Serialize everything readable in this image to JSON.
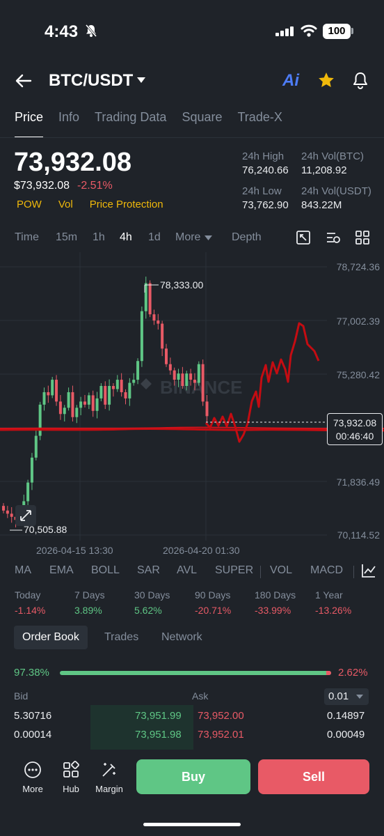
{
  "status_bar": {
    "time": "4:43",
    "battery": "100"
  },
  "header": {
    "pair": "BTC/USDT",
    "ai_label": "Ai"
  },
  "main_tabs": [
    {
      "label": "Price",
      "active": true
    },
    {
      "label": "Info"
    },
    {
      "label": "Trading Data"
    },
    {
      "label": "Square"
    },
    {
      "label": "Trade-X"
    }
  ],
  "price": {
    "last": "73,932.08",
    "fiat": "$73,932.08",
    "change": "-2.51%",
    "tags": [
      "POW",
      "Vol",
      "Price Protection"
    ]
  },
  "stats": {
    "high_label": "24h High",
    "high": "76,240.66",
    "vol_btc_label": "24h Vol(BTC)",
    "vol_btc": "11,208.92",
    "low_label": "24h Low",
    "low": "73,762.90",
    "vol_usdt_label": "24h Vol(USDT)",
    "vol_usdt": "843.22M"
  },
  "chart_toolbar": {
    "time": "Time",
    "m15": "15m",
    "h1": "1h",
    "h4": "4h",
    "d1": "1d",
    "more": "More",
    "depth": "Depth"
  },
  "chart_data": {
    "type": "candlestick",
    "interval": "4h",
    "y_ticks": [
      "78,724.36",
      "77,002.39",
      "75,280.42",
      "71,836.49",
      "70,114.52"
    ],
    "x_ticks": [
      "2026-04-15 13:30",
      "2026-04-20 01:30"
    ],
    "high_marker": "78,333.00",
    "low_marker": "70,505.88",
    "last_price_label": "73,932.08",
    "countdown": "00:46:40",
    "watermark": "BINANCE",
    "ylim": [
      70114.52,
      78724.36
    ],
    "candles_close": [
      70900,
      70800,
      70700,
      70600,
      70650,
      71200,
      71800,
      72600,
      73300,
      74300,
      74700,
      74600,
      75100,
      74400,
      74000,
      74200,
      74700,
      73900,
      74200,
      74400,
      74300,
      74600,
      74100,
      74500,
      74900,
      74300,
      74900,
      74800,
      75100,
      74700,
      74500,
      75000,
      75100,
      75700,
      77300,
      78200,
      77200,
      77000,
      76900,
      76100,
      75600,
      75400,
      75100,
      75300,
      74900,
      75300,
      75100,
      75000,
      75600,
      74400,
      73932
    ]
  },
  "indicators": [
    "MA",
    "EMA",
    "BOLL",
    "SAR",
    "AVL",
    "SUPER",
    "VOL",
    "MACD"
  ],
  "performance": [
    {
      "label": "Today",
      "value": "-1.14%",
      "dir": "down"
    },
    {
      "label": "7 Days",
      "value": "3.89%",
      "dir": "up"
    },
    {
      "label": "30 Days",
      "value": "5.62%",
      "dir": "up"
    },
    {
      "label": "90 Days",
      "value": "-20.71%",
      "dir": "down"
    },
    {
      "label": "180 Days",
      "value": "-33.99%",
      "dir": "down"
    },
    {
      "label": "1 Year",
      "value": "-13.26%",
      "dir": "down"
    }
  ],
  "orderbook_tabs": [
    "Order Book",
    "Trades",
    "Network"
  ],
  "orderbook": {
    "bid_pct": "97.38%",
    "ask_pct": "2.62%",
    "bid_pct_value": 0.9738,
    "bid_label": "Bid",
    "ask_label": "Ask",
    "step": "0.01",
    "rows": [
      {
        "bid_qty": "5.30716",
        "bid_price": "73,951.99",
        "ask_price": "73,952.00",
        "ask_qty": "0.14897"
      },
      {
        "bid_qty": "0.00014",
        "bid_price": "73,951.98",
        "ask_price": "73,952.01",
        "ask_qty": "0.00049"
      }
    ]
  },
  "bottom_bar": {
    "more": "More",
    "hub": "Hub",
    "margin": "Margin",
    "buy": "Buy",
    "sell": "Sell"
  },
  "colors": {
    "up": "#5fc685",
    "down": "#e85a66",
    "accent": "#f0b90b",
    "background": "#1f2329"
  }
}
